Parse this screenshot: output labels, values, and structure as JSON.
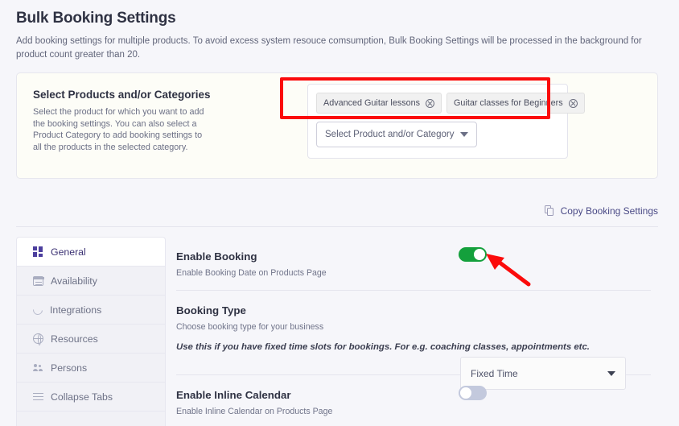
{
  "page": {
    "title": "Bulk Booking Settings",
    "description": "Add booking settings for multiple products. To avoid excess system resouce comsumption, Bulk Booking Settings will be processed in the background for product count greater than 20."
  },
  "products_card": {
    "heading": "Select Products and/or Categories",
    "description": "Select the product for which you want to add the booking settings. You can also select a Product Category to add booking settings to all the products in the selected category.",
    "chips": [
      {
        "label": "Advanced Guitar lessons",
        "remove_icon": "circle-x-icon"
      },
      {
        "label": "Guitar classes for Beginners",
        "remove_icon": "circle-x-icon"
      }
    ],
    "dropdown": {
      "value": "Select Product and/or Category",
      "placeholder": "Select Product and/or Category",
      "caret_icon": "chevron-down-icon"
    }
  },
  "copy_link": {
    "label": "Copy Booking Settings",
    "icon": "copy-icon",
    "color": "#4a4a86"
  },
  "tabs": [
    {
      "label": "General",
      "icon": "grid-icon",
      "active": true
    },
    {
      "label": "Availability",
      "icon": "calendar-icon",
      "active": false
    },
    {
      "label": "Integrations",
      "icon": "refresh-icon",
      "active": false
    },
    {
      "label": "Resources",
      "icon": "globe-icon",
      "active": false
    },
    {
      "label": "Persons",
      "icon": "persons-icon",
      "active": false
    },
    {
      "label": "Collapse Tabs",
      "icon": "hamburger-icon",
      "active": false
    }
  ],
  "settings": {
    "enable_booking": {
      "title": "Enable Booking",
      "subtitle": "Enable Booking Date on Products Page",
      "toggle_state": "on"
    },
    "booking_type": {
      "title": "Booking Type",
      "subtitle": "Choose booking type for your business",
      "value": "Fixed Time",
      "caret_icon": "chevron-down-icon",
      "note": "Use this if you have fixed time slots for bookings. For e.g. coaching classes, appointments etc."
    },
    "enable_inline_calendar": {
      "title": "Enable Inline Calendar",
      "subtitle": "Enable Inline Calendar on Products Page",
      "toggle_state": "off"
    }
  },
  "annotations": {
    "highlight_box_color": "#fb0b0b",
    "arrow_color": "#fb0b0b",
    "arrow_target": "enable-booking-toggle"
  },
  "colors": {
    "accent_purple": "#4c3f9e",
    "toggle_on_green": "#14a03c",
    "toggle_off_gray": "#c3c9dd",
    "page_background": "#f6f6fa"
  }
}
